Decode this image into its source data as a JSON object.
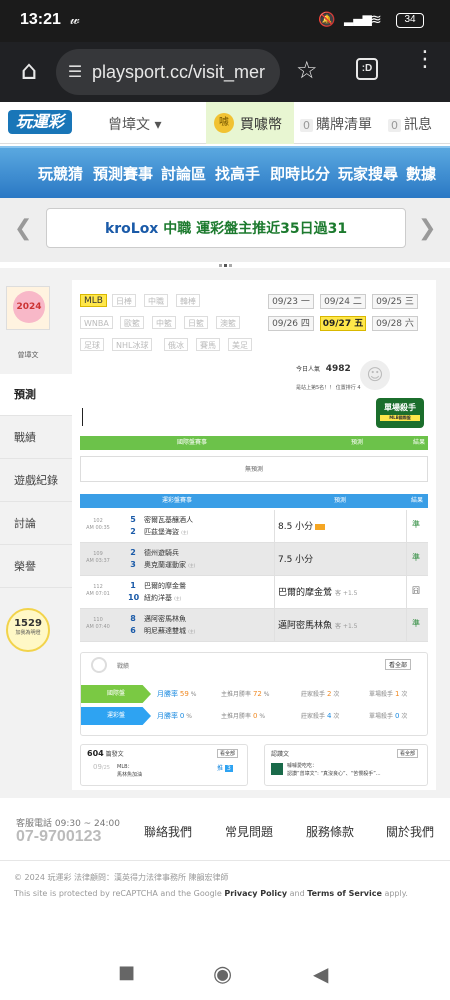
{
  "status_bar": {
    "time": "13:21",
    "signal_text": "⁴ᵍ",
    "battery": "34"
  },
  "browser": {
    "url": "playsport.cc/visit_mer",
    "tab_count": ":D"
  },
  "site_header": {
    "logo": "玩運彩",
    "username": "曾墇文 ▾",
    "buy_coin": "買噱幣",
    "cart_count": "0",
    "cart_label": "購牌清單",
    "msg_count": "0",
    "msg_label": "訊息"
  },
  "nav": [
    "玩競猜",
    "預測賽事",
    "討論區",
    "找高手",
    "即時比分",
    "玩家搜尋",
    "數據"
  ],
  "banner": {
    "brand": "kroLox",
    "text": " 中職 運彩盤主推近35日過31"
  },
  "profile": {
    "name": "曾墇文",
    "avatar_text": "2024"
  },
  "side_tabs": [
    "預測",
    "戰績",
    "遊戲紀錄",
    "討論",
    "榮譽"
  ],
  "online": {
    "count": "1529",
    "label": "加我為明燈"
  },
  "league_tags": [
    [
      "MLB",
      "日棒",
      "中職",
      "韓棒"
    ],
    [
      "WNBA",
      "歐籃",
      "中籃",
      "日籃",
      "澳籃"
    ],
    [
      "足球",
      "NHL冰球",
      "俄冰",
      "賽馬",
      "美足"
    ]
  ],
  "dates": [
    {
      "md": "09/23",
      "wd": "一"
    },
    {
      "md": "09/24",
      "wd": "二"
    },
    {
      "md": "09/25",
      "wd": "三"
    },
    {
      "md": "09/26",
      "wd": "四"
    },
    {
      "md": "09/27",
      "wd": "五"
    },
    {
      "md": "09/28",
      "wd": "六"
    }
  ],
  "visits": {
    "label": "今日人氣",
    "value": "4982",
    "rank_text": "是站上第5名！！ 位置排行 4"
  },
  "killer_badge": {
    "title": "單場殺手",
    "sub": "MLB國際盤"
  },
  "intl_table": {
    "headers": [
      "國際盤賽事",
      "預測",
      "結果"
    ],
    "empty_text": "無預測"
  },
  "lottery_table": {
    "headers": [
      "運彩盤賽事",
      "預測",
      "結果"
    ],
    "rows": [
      {
        "id": "102",
        "time": "AM 00:35",
        "nums": [
          "5",
          "2"
        ],
        "teams": [
          "密爾瓦基釀酒人",
          "匹茲堡海盜"
        ],
        "sub": "(主)",
        "pick": "8.5 小分",
        "odds": "",
        "result": "準"
      },
      {
        "id": "109",
        "time": "AM 03:37",
        "nums": [
          "2",
          "3"
        ],
        "teams": [
          "德州遊騎兵",
          "奧克蘭運動家"
        ],
        "sub": "(主)",
        "pick": "7.5 小分",
        "odds": "",
        "result": "準"
      },
      {
        "id": "112",
        "time": "AM 07:01",
        "nums": [
          "1",
          "10"
        ],
        "teams": [
          "巴爾的摩金鶯",
          "紐約洋基"
        ],
        "sub": "(主)",
        "pick": "巴爾的摩金鶯",
        "odds": "客 +1.5",
        "result": "囧"
      },
      {
        "id": "110",
        "time": "AM 07:40",
        "nums": [
          "8",
          "6"
        ],
        "teams": [
          "邁阿密馬林魚",
          "明尼蘇達雙城"
        ],
        "sub": "(主)",
        "pick": "邁阿密馬林魚",
        "odds": "客 +1.5",
        "result": "準"
      }
    ]
  },
  "stats": {
    "title": "戰績",
    "see_all": "看全部",
    "rows": [
      {
        "label": "國際盤",
        "color": "#7ac943",
        "monthly": "月勝率",
        "monthly_val": "59",
        "home": "主推月勝率",
        "home_val": "72",
        "killer": "莊家殺手",
        "killer_val": "2",
        "single": "單場殺手",
        "single_val": "1"
      },
      {
        "label": "運彩盤",
        "color": "#2ea3f2",
        "monthly": "月勝率",
        "monthly_val": "0",
        "home": "主推月勝率",
        "home_val": "0",
        "killer": "莊家殺手",
        "killer_val": "4",
        "single": "單場殺手",
        "single_val": "0"
      }
    ]
  },
  "articles": {
    "count": "604",
    "label": "篇發文",
    "see_all": "看全部",
    "item_date": "09",
    "item_sub": "/25",
    "item_league": "MLB：",
    "item_title": "馬林魚加油",
    "item_pushes": "3",
    "push_label": "推"
  },
  "recent": {
    "label": "認讚文",
    "see_all": "看全部",
    "item_title": "噱噱愛吃吃：",
    "item_text": "認讚”曾墇文”: “真沒良心”、“苦慢殺手”..."
  },
  "footer": {
    "service_label": "客服電話 09:30 ~ 24:00",
    "phone": "07-9700123",
    "links": [
      "聯絡我們",
      "常見問題",
      "服務條款",
      "關於我們"
    ],
    "copyright": "© 2024 玩運彩 法律顧問：漢英得力法律事務所 陳韻宏律師",
    "recaptcha_prefix": "This site is protected by reCAPTCHA and the Google ",
    "privacy": "Privacy Policy",
    "and": " and ",
    "terms": "Terms of Service",
    "apply": " apply."
  }
}
